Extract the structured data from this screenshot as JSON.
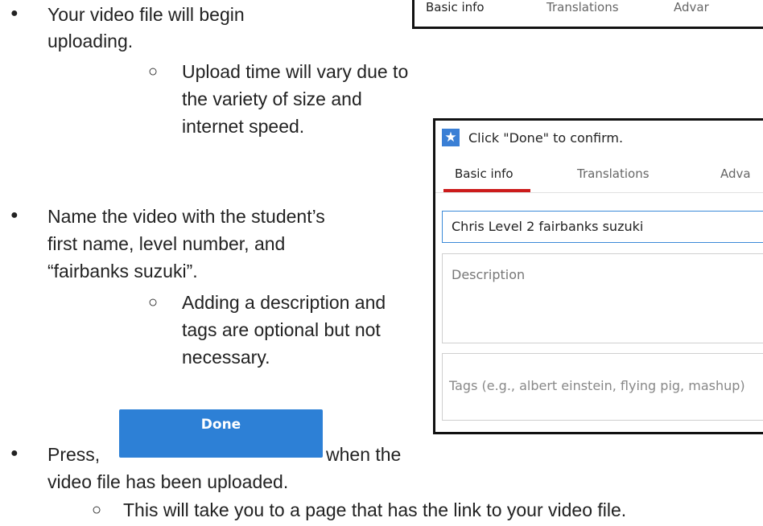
{
  "instructions": {
    "step1": {
      "line1": "Your video file will begin",
      "line2": "uploading.",
      "sub": {
        "line1": "Upload time will vary due to",
        "line2": "the variety of size and",
        "line3": "internet speed."
      }
    },
    "step2": {
      "line1": "Name the video with the student’s",
      "line2": "first name, level number, and",
      "line3": "“fairbanks suzuki”.",
      "sub": {
        "line1": "Adding a description and",
        "line2": "tags are optional but not",
        "line3": "necessary."
      }
    },
    "step3": {
      "prefix": "Press,",
      "suffix": "when the",
      "line2": "video file has been uploaded.",
      "sub": {
        "line1": "This will take you to a page that has the link to your video file."
      }
    },
    "bullet_glyph": "●",
    "sub_bullet_glyph": "○"
  },
  "top_screenshot": {
    "tabs": [
      "Basic info",
      "Translations",
      "Advar"
    ]
  },
  "upload_screenshot": {
    "notice": "Click \"Done\" to confirm.",
    "tabs": [
      "Basic info",
      "Translations",
      "Adva"
    ],
    "title_value": "Chris Level 2 fairbanks suzuki",
    "description_placeholder": "Description",
    "tags_placeholder": "Tags (e.g., albert einstein, flying pig, mashup)"
  },
  "done_button": {
    "label": "Done"
  },
  "colors": {
    "accent_blue": "#2d80d6",
    "tab_active_red": "#cc1b1b",
    "field_focus_blue": "#3b8ad8"
  }
}
